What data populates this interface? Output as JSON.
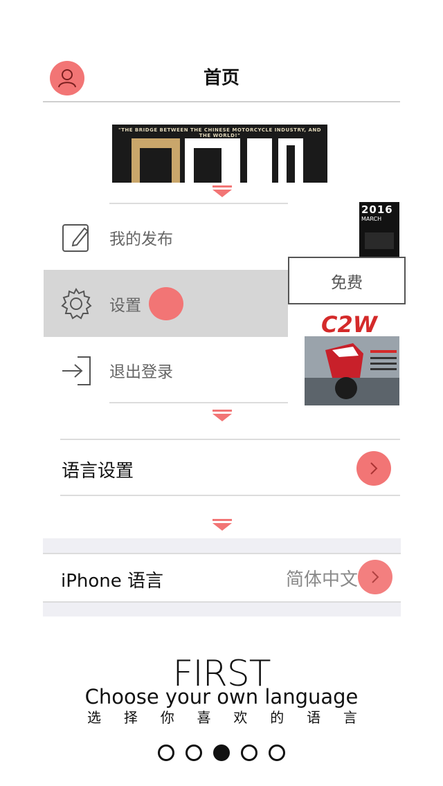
{
  "header": {
    "title": "首页",
    "avatar_icon": "user-icon"
  },
  "banner": {
    "tagline": "\"THE BRIDGE BETWEEN THE CHINESE MOTORCYCLE INDUSTRY, AND THE WORLD!\""
  },
  "menu": {
    "items": [
      {
        "label": "我的发布",
        "icon": "edit-icon"
      },
      {
        "label": "设置",
        "icon": "gear-icon"
      },
      {
        "label": "退出登录",
        "icon": "logout-icon"
      }
    ]
  },
  "side": {
    "mag_a_year": "2016",
    "mag_a_month": "MARCH",
    "free_label": "免费",
    "mag_b_logo": "C2W"
  },
  "language": {
    "settings_label": "语言设置",
    "iphone_label": "iPhone 语言",
    "iphone_value": "简体中文"
  },
  "intro": {
    "heading": "FIRST",
    "subheading": "Choose your own language",
    "chars": [
      "选",
      "择",
      "你",
      "喜",
      "欢",
      "的",
      "语",
      "言"
    ]
  },
  "pager": {
    "count": 5,
    "active_index": 2
  },
  "colors": {
    "accent": "#f27575",
    "selected_row": "#d6d6d6",
    "band": "#efeff4"
  }
}
